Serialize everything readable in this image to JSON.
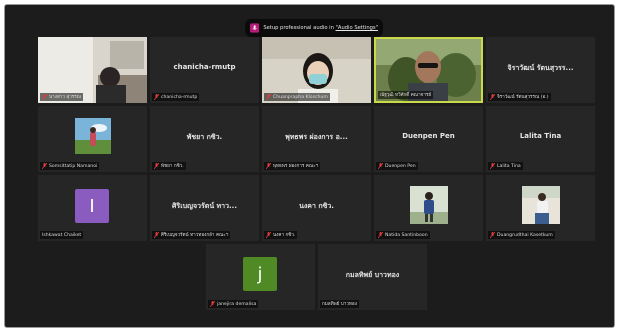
{
  "banner": {
    "prefix": "Setup professional audio in ",
    "link": "\"Audio Settings\""
  },
  "colors": {
    "accent_speaker_border": "#c9d94a",
    "tile_bg": "#262626",
    "muted_icon": "#e23c3c",
    "avatar_purple": "#8a5cc0",
    "avatar_green": "#4f8a25"
  },
  "tiles": {
    "t1": {
      "label": "นางสาว สุวรรณ"
    },
    "t2": {
      "center": "chanicha-rmutp",
      "label": "chanicha-rmutp"
    },
    "t3": {
      "label": "Chuanprapha Kloschum"
    },
    "t4": {
      "label": "ณัฐวุฒิ ทวีศักดิ์ คณาจารย์"
    },
    "t5": {
      "center": "จิราวัฒน์ รัตนสุวรร...",
      "label": "จิราวัฒน์ รัตนสุวรรณ (อ.)"
    },
    "t6": {
      "label": "Somsittatip Namanoi"
    },
    "t7": {
      "center": "พัชยา กซิว.",
      "label": "พัชยา กซิว."
    },
    "t8": {
      "center": "พุทธพร ผ่องการ อ...",
      "label": "พุทธพร ผ่องการ คณะฯ"
    },
    "t9": {
      "center": "Duenpen Pen",
      "label": "Duenpen Pen"
    },
    "t10": {
      "center": "Lalita Tina",
      "label": "Lalita Tina"
    },
    "t11": {
      "initial": "I",
      "label": "Ishkawat Chaiket"
    },
    "t12": {
      "center": "ศิริเบญจวรัตน์ ทาว...",
      "label": "ศิริเบญจวรัตน์ ทาวทองกล้า คณะฯ"
    },
    "t13": {
      "center": "นงคา กซิว.",
      "label": "นงคา กซิว."
    },
    "t14": {
      "label": "Natida Santinboon"
    },
    "t15": {
      "label": "Duangrudthai Kasetkum"
    },
    "t16": {
      "initial": "j",
      "label": "janejira demalisa"
    },
    "t17": {
      "center": "กมลทิพย์ บาวทอง",
      "label": "กมลทิพย์ บาวทอง"
    }
  }
}
